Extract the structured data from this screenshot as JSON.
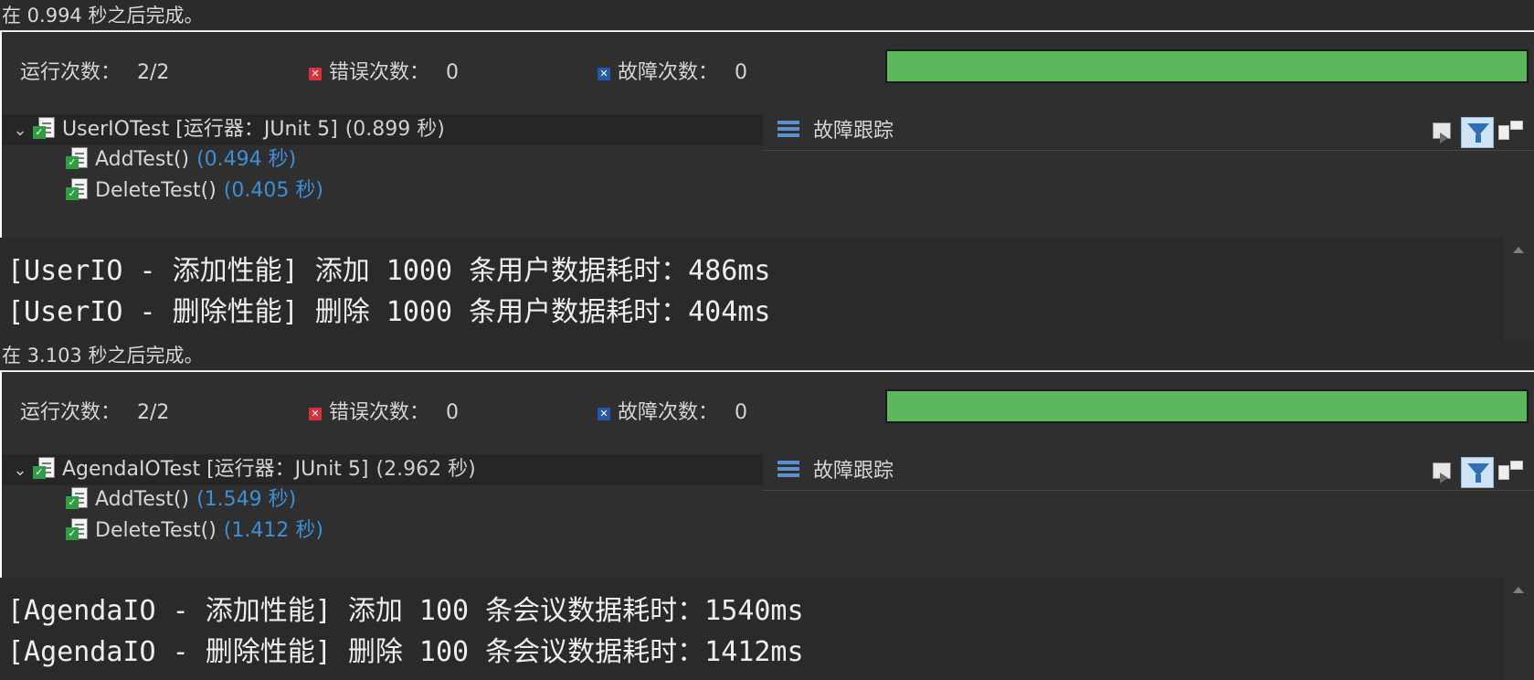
{
  "panels": [
    {
      "status": "在 0.994 秒之后完成。",
      "counters": {
        "runs_label": "运行次数：",
        "runs_value": "2/2",
        "errors_label": "错误次数：",
        "errors_value": "0",
        "failures_label": "故障次数：",
        "failures_value": "0"
      },
      "progress": {
        "fraction": 1.0,
        "color": "#5cb85c"
      },
      "tree": {
        "root_name": "UserIOTest",
        "root_runner": "[运行器：JUnit 5]",
        "root_time": "(0.899 秒)",
        "tests": [
          {
            "name": "AddTest()",
            "time": "(0.494 秒)"
          },
          {
            "name": "DeleteTest()",
            "time": "(0.405 秒)"
          }
        ]
      },
      "trace_title": "故障跟踪",
      "console": [
        "[UserIO - 添加性能] 添加 1000 条用户数据耗时：486ms",
        "[UserIO - 删除性能] 删除 1000 条用户数据耗时：404ms"
      ]
    },
    {
      "status": "在 3.103 秒之后完成。",
      "counters": {
        "runs_label": "运行次数：",
        "runs_value": "2/2",
        "errors_label": "错误次数：",
        "errors_value": "0",
        "failures_label": "故障次数：",
        "failures_value": "0"
      },
      "progress": {
        "fraction": 1.0,
        "color": "#5cb85c"
      },
      "tree": {
        "root_name": "AgendaIOTest",
        "root_runner": "[运行器：JUnit 5]",
        "root_time": "(2.962 秒)",
        "tests": [
          {
            "name": "AddTest()",
            "time": "(1.549 秒)"
          },
          {
            "name": "DeleteTest()",
            "time": "(1.412 秒)"
          }
        ]
      },
      "trace_title": "故障跟踪",
      "console": [
        "[AgendaIO - 添加性能] 添加 100 条会议数据耗时：1540ms",
        "[AgendaIO - 删除性能] 删除 100 条会议数据耗时：1412ms"
      ]
    }
  ],
  "icons": {
    "error": "error-icon",
    "failure": "failure-icon",
    "test_suite": "test-suite-icon",
    "test_case": "test-case-icon",
    "expand": "chevron-down-icon",
    "stack_trace": "stack-trace-icon",
    "compare": "compare-result-icon",
    "filter": "filter-trace-icon",
    "layout": "layout-toggle-icon",
    "scroll_up": "scroll-up-icon"
  }
}
